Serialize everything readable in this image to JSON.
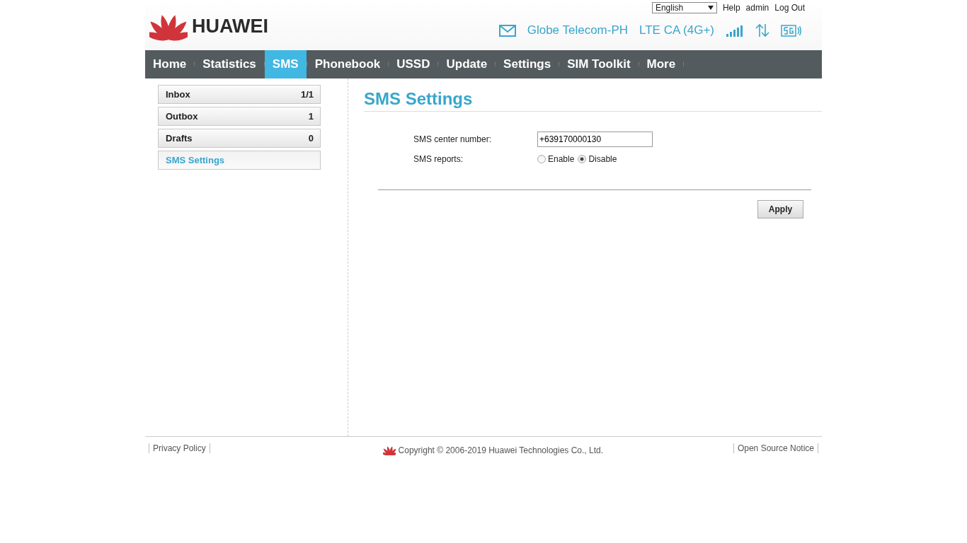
{
  "header": {
    "logo": "HUAWEI",
    "language": "English",
    "links": [
      "Help",
      "admin",
      "Log Out"
    ],
    "operator": "Globe Telecom-PH",
    "network": "LTE CA (4G+)"
  },
  "nav": [
    {
      "label": "Home",
      "selected": false
    },
    {
      "label": "Statistics",
      "selected": false
    },
    {
      "label": "SMS",
      "selected": true
    },
    {
      "label": "Phonebook",
      "selected": false
    },
    {
      "label": "USSD",
      "selected": false
    },
    {
      "label": "Update",
      "selected": false
    },
    {
      "label": "Settings",
      "selected": false
    },
    {
      "label": "SIM Toolkit",
      "selected": false
    },
    {
      "label": "More",
      "selected": false
    }
  ],
  "sidebar": [
    {
      "label": "Inbox",
      "count": "1/1",
      "selected": false
    },
    {
      "label": "Outbox",
      "count": "1",
      "selected": false
    },
    {
      "label": "Drafts",
      "count": "0",
      "selected": false
    },
    {
      "label": "SMS Settings",
      "selected": true
    }
  ],
  "content": {
    "title": "SMS Settings",
    "fields": [
      {
        "kind": "text",
        "label": "SMS center number:",
        "value": "+639170000130"
      },
      {
        "kind": "radio",
        "label": "SMS reports:",
        "options": [
          {
            "label": "Enable",
            "selected": false
          },
          {
            "label": "Disable",
            "selected": true
          }
        ]
      }
    ],
    "button": "Apply"
  },
  "footer": {
    "left": "Privacy Policy",
    "copyright": "Copyright © 2006-2019 Huawei Technologies Co., Ltd.",
    "right": "Open Source Notice"
  }
}
